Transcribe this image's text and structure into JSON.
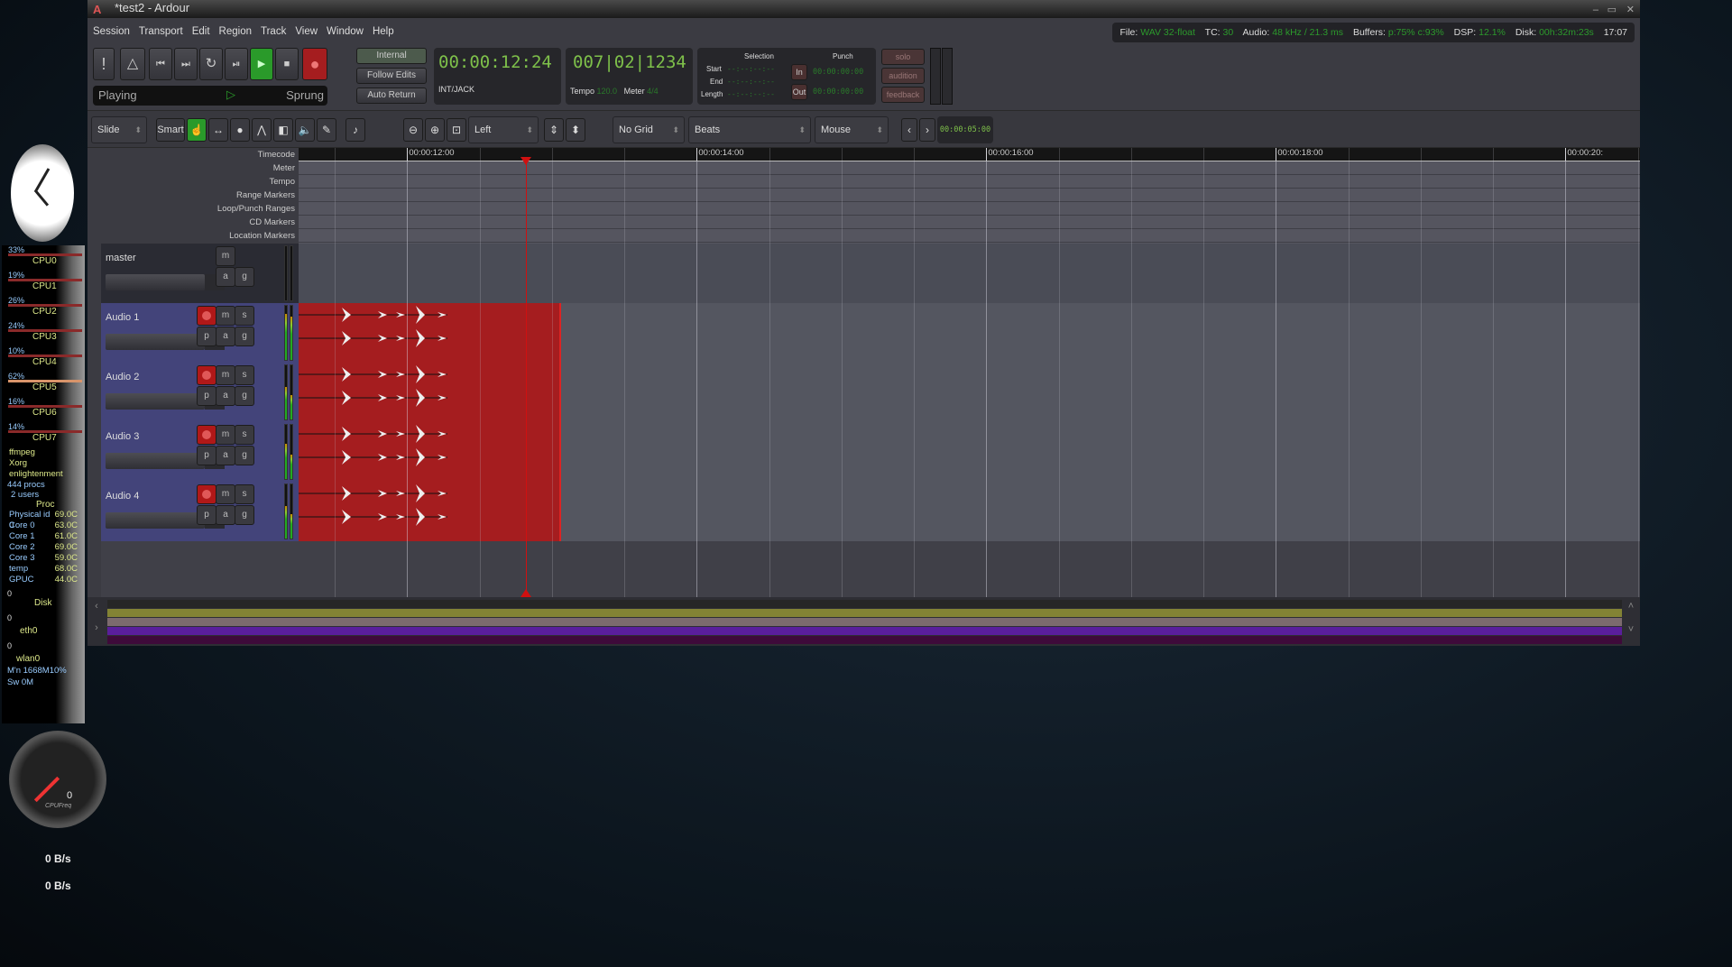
{
  "window": {
    "title": "*test2 - Ardour",
    "min": "‒",
    "max": "▭",
    "close": "✕"
  },
  "menu": [
    "Session",
    "Transport",
    "Edit",
    "Region",
    "Track",
    "View",
    "Window",
    "Help"
  ],
  "status": {
    "file_label": "File:",
    "file": "WAV 32-float",
    "tc_label": "TC:",
    "tc": "30",
    "audio_label": "Audio:",
    "audio": "48 kHz / 21.3 ms",
    "buffers_label": "Buffers:",
    "buffers": "p:75% c:93%",
    "dsp_label": "DSP:",
    "dsp": "12.1%",
    "disk_label": "Disk:",
    "disk": "00h:32m:23s",
    "time": "17:07"
  },
  "transport": {
    "state": "Playing",
    "sprung": "Sprung",
    "internal": "Internal",
    "follow_edits": "Follow Edits",
    "auto_return": "Auto Return",
    "primary_clock": "00:00:12:24",
    "sync": "INT/JACK",
    "secondary_clock": "007|02|1234",
    "tempo_label": "Tempo",
    "tempo": "120.0",
    "meter_label": "Meter",
    "meter": "4/4"
  },
  "selection": {
    "title": "Selection",
    "start_label": "Start",
    "end_label": "End",
    "length_label": "Length",
    "start": "--:--:--:--",
    "end": "--:--:--:--",
    "length": "--:--:--:--"
  },
  "punch": {
    "title": "Punch",
    "in": "In",
    "out": "Out",
    "in_time": "00:00:00:00",
    "out_time": "00:00:00:00"
  },
  "monitor": {
    "solo": "solo",
    "audition": "audition",
    "feedback": "feedback"
  },
  "toolbar": {
    "edit_mode": "Slide",
    "smart": "Smart",
    "zoom_focus": "Left",
    "grid": "No Grid",
    "grid_type": "Beats",
    "edit_point": "Mouse",
    "nudge_clock": "00:00:05:00"
  },
  "rulers": [
    "Timecode",
    "Meter",
    "Tempo",
    "Range Markers",
    "Loop/Punch Ranges",
    "CD Markers",
    "Location Markers"
  ],
  "timeline": {
    "ticks": [
      "00:00:12:00",
      "00:00:14:00",
      "00:00:16:00",
      "00:00:18:00",
      "00:00:20:"
    ],
    "start_sec": 11.25,
    "playhead_sec": 12.82
  },
  "tracks": [
    {
      "name": "master",
      "type": "master",
      "buttons": [
        "m",
        "a",
        "g"
      ]
    },
    {
      "name": "Audio 1",
      "type": "audio",
      "buttons": [
        "m",
        "s",
        "p",
        "a",
        "g"
      ],
      "meter": [
        0.85,
        0.8
      ]
    },
    {
      "name": "Audio 2",
      "type": "audio",
      "buttons": [
        "m",
        "s",
        "p",
        "a",
        "g"
      ],
      "meter": [
        0.6,
        0.45
      ]
    },
    {
      "name": "Audio 3",
      "type": "audio",
      "buttons": [
        "m",
        "s",
        "p",
        "a",
        "g"
      ],
      "meter": [
        0.65,
        0.45
      ]
    },
    {
      "name": "Audio 4",
      "type": "audio",
      "buttons": [
        "m",
        "s",
        "p",
        "a",
        "g"
      ],
      "meter": [
        0.6,
        0.45
      ]
    }
  ],
  "sysmon": {
    "cpus": [
      {
        "name": "CPU0",
        "pct": "33%"
      },
      {
        "name": "CPU1",
        "pct": "19%"
      },
      {
        "name": "CPU2",
        "pct": "26%"
      },
      {
        "name": "CPU3",
        "pct": "24%"
      },
      {
        "name": "CPU4",
        "pct": "10%"
      },
      {
        "name": "CPU5",
        "pct": "62%"
      },
      {
        "name": "CPU6",
        "pct": "16%"
      },
      {
        "name": "CPU7",
        "pct": "14%"
      }
    ],
    "procs": [
      "ffmpeg",
      "Xorg",
      "enlightenment"
    ],
    "proc_count": "444 procs",
    "users": "2 users",
    "proc_title": "Proc",
    "temps": [
      {
        "k": "Physical id 0",
        "v": "69.0C"
      },
      {
        "k": "Core 0",
        "v": "63.0C"
      },
      {
        "k": "Core 1",
        "v": "61.0C"
      },
      {
        "k": "Core 2",
        "v": "69.0C"
      },
      {
        "k": "Core 3",
        "v": "59.0C"
      },
      {
        "k": "temp",
        "v": "68.0C"
      },
      {
        "k": "GPUC",
        "v": "44.0C"
      }
    ],
    "disk": "Disk",
    "eth": "eth0",
    "wlan": "wlan0",
    "zero": "0",
    "mem": "M'n 1668M10%",
    "swap": "Sw  0M",
    "cpufreq": "CPUFreq",
    "cpufreq_val": "0",
    "net_up": "0 B/s",
    "net_down": "0 B/s"
  },
  "colors": {
    "accent": "#2a9a2a",
    "region": "#a51d1f",
    "playhead": "#d01010",
    "track": "#43447a"
  }
}
